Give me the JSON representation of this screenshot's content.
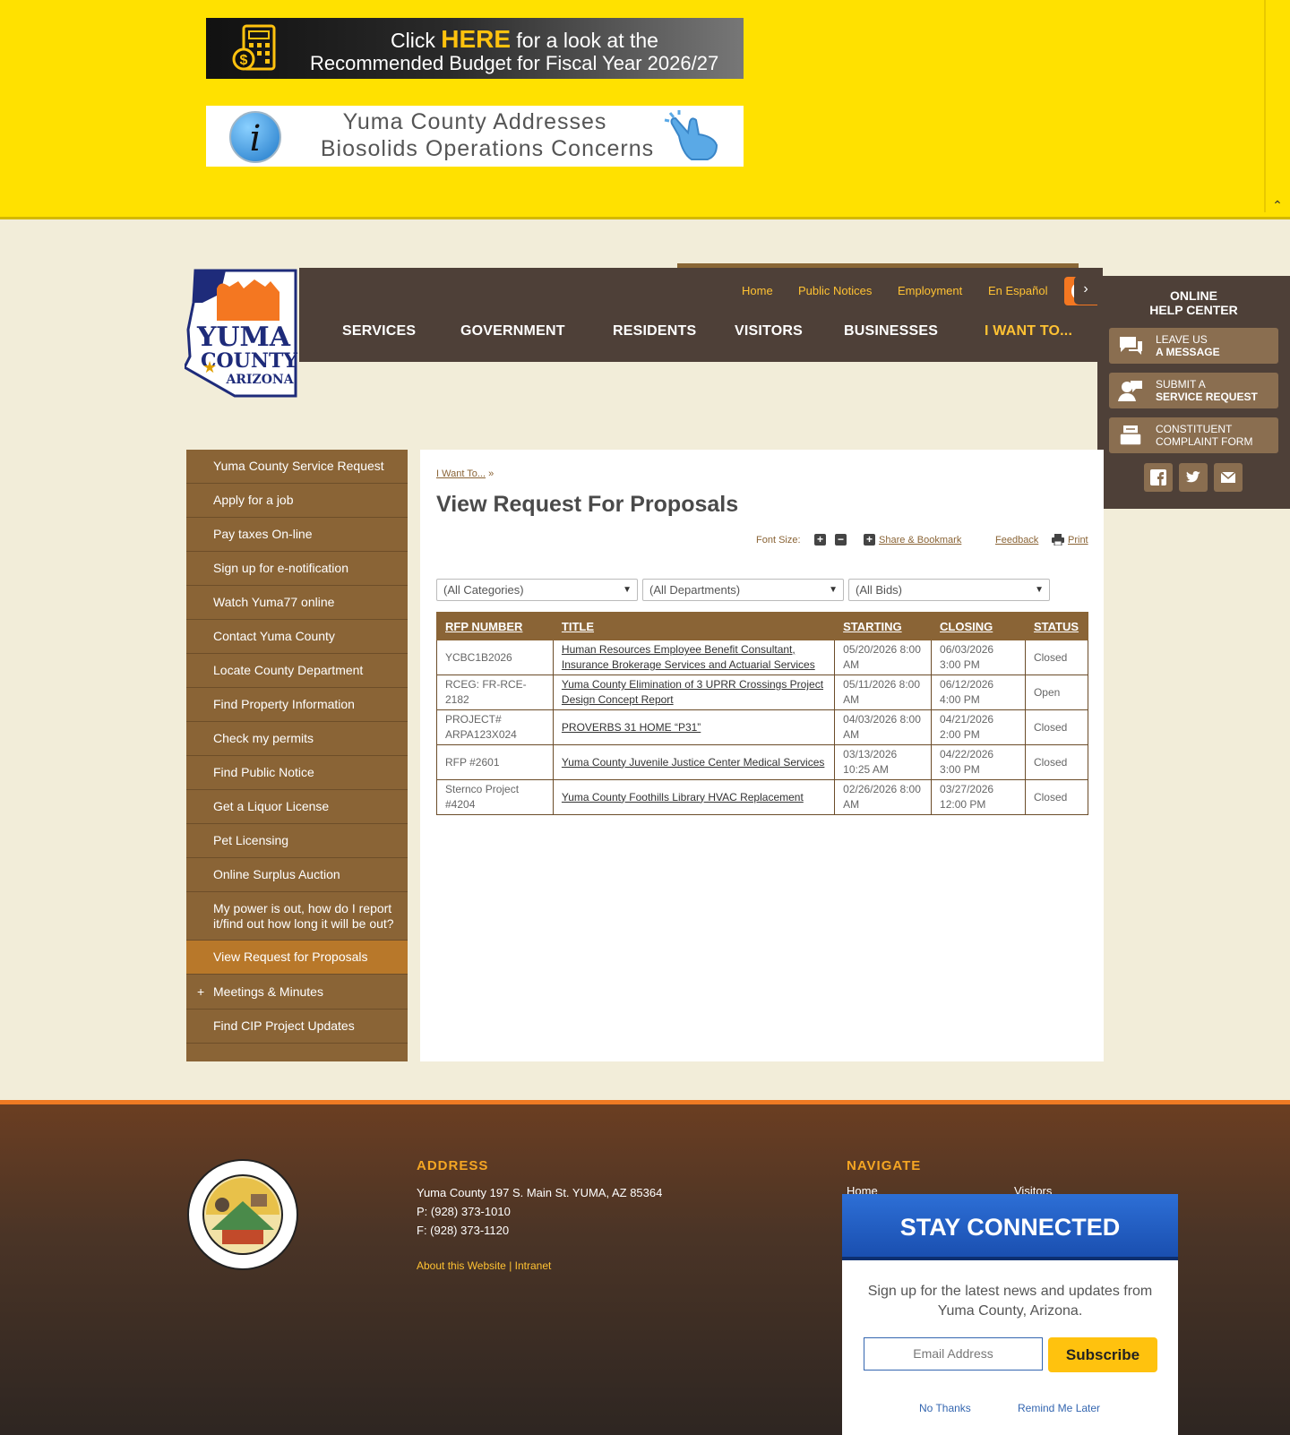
{
  "promos": {
    "budget": {
      "line1_pre": "Click ",
      "line1_here": "HERE",
      "line1_post": " for a look at the",
      "line2": "Recommended Budget for Fiscal Year 2026/27"
    },
    "biosolids": {
      "line1": "Yuma County Addresses",
      "line2": "Biosolids Operations Concerns"
    }
  },
  "header": {
    "logo_text": [
      "YUMA",
      "COUNTY",
      "ARIZONA"
    ],
    "utility": [
      "Home",
      "Public Notices",
      "Employment",
      "En Español"
    ],
    "nav": [
      "SERVICES",
      "GOVERNMENT",
      "RESIDENTS",
      "VISITORS",
      "BUSINESSES",
      "I WANT TO..."
    ]
  },
  "help_center": {
    "title_line1": "ONLINE",
    "title_line2": "HELP CENTER",
    "buttons": [
      {
        "line1": "LEAVE US",
        "line2": "A MESSAGE"
      },
      {
        "line1": "SUBMIT A",
        "line2": "SERVICE REQUEST"
      },
      {
        "line1": "CONSTITUENT",
        "line2": "COMPLAINT FORM"
      }
    ]
  },
  "sidebar": {
    "items": [
      "Yuma County Service Request",
      "Apply for a job",
      "Pay taxes On-line",
      "Sign up for e-notification",
      "Watch Yuma77 online",
      "Contact Yuma County",
      "Locate County Department",
      "Find Property Information",
      "Check my permits",
      "Find Public Notice",
      "Get a Liquor License",
      "Pet Licensing",
      "Online Surplus Auction",
      "My power is out, how do I report it/find out how long it will be out?",
      "View Request for Proposals",
      "Meetings & Minutes",
      "Find CIP Project Updates"
    ],
    "expand_symbol": "+"
  },
  "content": {
    "breadcrumb": "I Want To...",
    "breadcrumb_sep": "»",
    "title": "View Request For Proposals",
    "tools": {
      "font_size": "Font Size:",
      "plus": "+",
      "minus": "−",
      "share": "Share & Bookmark",
      "feedback": "Feedback",
      "print": "Print"
    },
    "filters": [
      "(All Categories)",
      "(All Departments)",
      "(All Bids)"
    ],
    "table": {
      "headers": [
        "RFP NUMBER",
        "TITLE",
        "STARTING",
        "CLOSING",
        "STATUS"
      ],
      "rows": [
        [
          "YCBC1B2026",
          "Human Resources Employee Benefit Consultant, Insurance Brokerage Services and Actuarial Services",
          "05/20/2026 8:00 AM",
          "06/03/2026 3:00 PM",
          "Closed"
        ],
        [
          "RCEG: FR-RCE-2182",
          "Yuma County Elimination of 3 UPRR Crossings Project Design Concept Report",
          "05/11/2026 8:00 AM",
          "06/12/2026 4:00 PM",
          "Open"
        ],
        [
          "PROJECT# ARPA123X024",
          "PROVERBS 31 HOME “P31”",
          "04/03/2026 8:00 AM",
          "04/21/2026 2:00 PM",
          "Closed"
        ],
        [
          "RFP #2601",
          "Yuma County Juvenile Justice Center Medical Services",
          "03/13/2026 10:25 AM",
          "04/22/2026 3:00 PM",
          "Closed"
        ],
        [
          "Sternco Project #4204",
          "Yuma County Foothills Library HVAC Replacement",
          "02/26/2026 8:00 AM",
          "03/27/2026 12:00 PM",
          "Closed"
        ]
      ]
    }
  },
  "footer": {
    "address_heading": "ADDRESS",
    "address": "Yuma County 197 S. Main St. YUMA, AZ 85364",
    "phone": "P: (928) 373-1010",
    "fax": "F: (928) 373-1120",
    "about": "About this Website",
    "sep": "|",
    "intranet": "Intranet",
    "navigate_heading": "NAVIGATE",
    "nav_links": [
      "Home",
      "Visitors"
    ]
  },
  "popup": {
    "heading": "STAY CONNECTED",
    "text": "Sign up for the latest news and updates from Yuma County, Arizona.",
    "email_placeholder": "Email Address",
    "subscribe": "Subscribe",
    "no_thanks": "No Thanks",
    "remind": "Remind Me Later"
  },
  "colors": {
    "banner_yellow": "#ffe100",
    "nav_brown": "#4e4038",
    "side_brown": "#8a6436",
    "accent_gold": "#ffc233",
    "orange": "#f47721",
    "popup_blue": "#1a4fb0"
  }
}
